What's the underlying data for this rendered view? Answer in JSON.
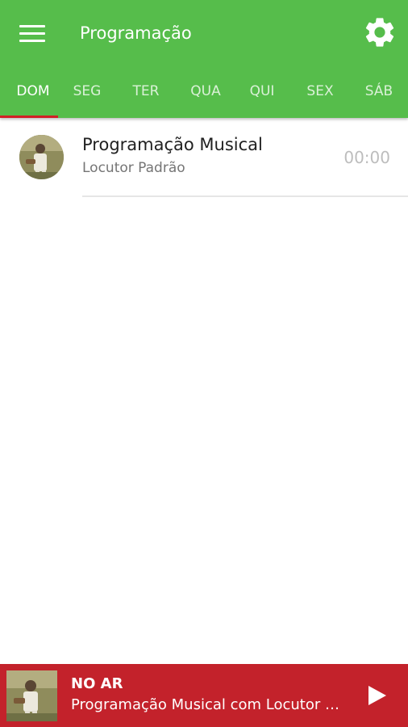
{
  "app": {
    "title": "Programação"
  },
  "tabs": [
    {
      "label": "DOM",
      "active": true
    },
    {
      "label": "SEG"
    },
    {
      "label": "TER"
    },
    {
      "label": "QUA"
    },
    {
      "label": "QUI"
    },
    {
      "label": "SEX"
    },
    {
      "label": "SÁB"
    }
  ],
  "schedule": [
    {
      "title": "Programação Musical",
      "host": "Locutor Padrão",
      "time": "00:00"
    }
  ],
  "player": {
    "label": "NO AR",
    "now_playing": "Programação Musical com Locutor Padrão"
  },
  "colors": {
    "primary": "#56bd4b",
    "accent": "#d11f26",
    "player_bg": "#c3222b"
  },
  "icons": {
    "menu": "hamburger-menu-icon",
    "settings": "gear-icon",
    "play": "play-icon",
    "avatar": "host-avatar-photo"
  }
}
